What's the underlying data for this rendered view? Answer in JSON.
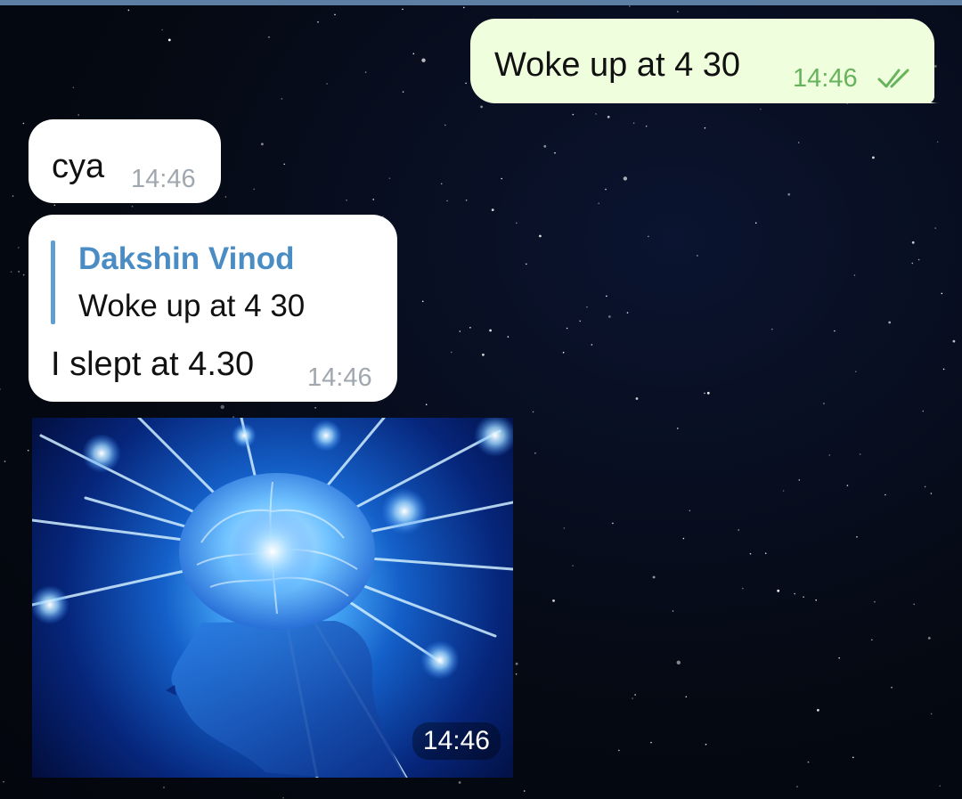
{
  "messages": [
    {
      "type": "outgoing",
      "text": "Woke up at 4 30",
      "time": "14:46",
      "status_icon": "double-check-icon"
    },
    {
      "type": "incoming",
      "text": "cya",
      "time": "14:46"
    },
    {
      "type": "incoming-reply",
      "reply_name": "Dakshin Vinod",
      "reply_text": "Woke up at 4 30",
      "text": "I slept at 4.30",
      "time": "14:46"
    },
    {
      "type": "incoming-image",
      "image_desc": "glowing blue brain head",
      "time": "14:46"
    }
  ],
  "colors": {
    "outgoing_bubble": "#effedd",
    "incoming_bubble": "#ffffff",
    "reply_accent": "#4a8cc4",
    "read_check": "#66b35c",
    "background": "#060b17"
  }
}
